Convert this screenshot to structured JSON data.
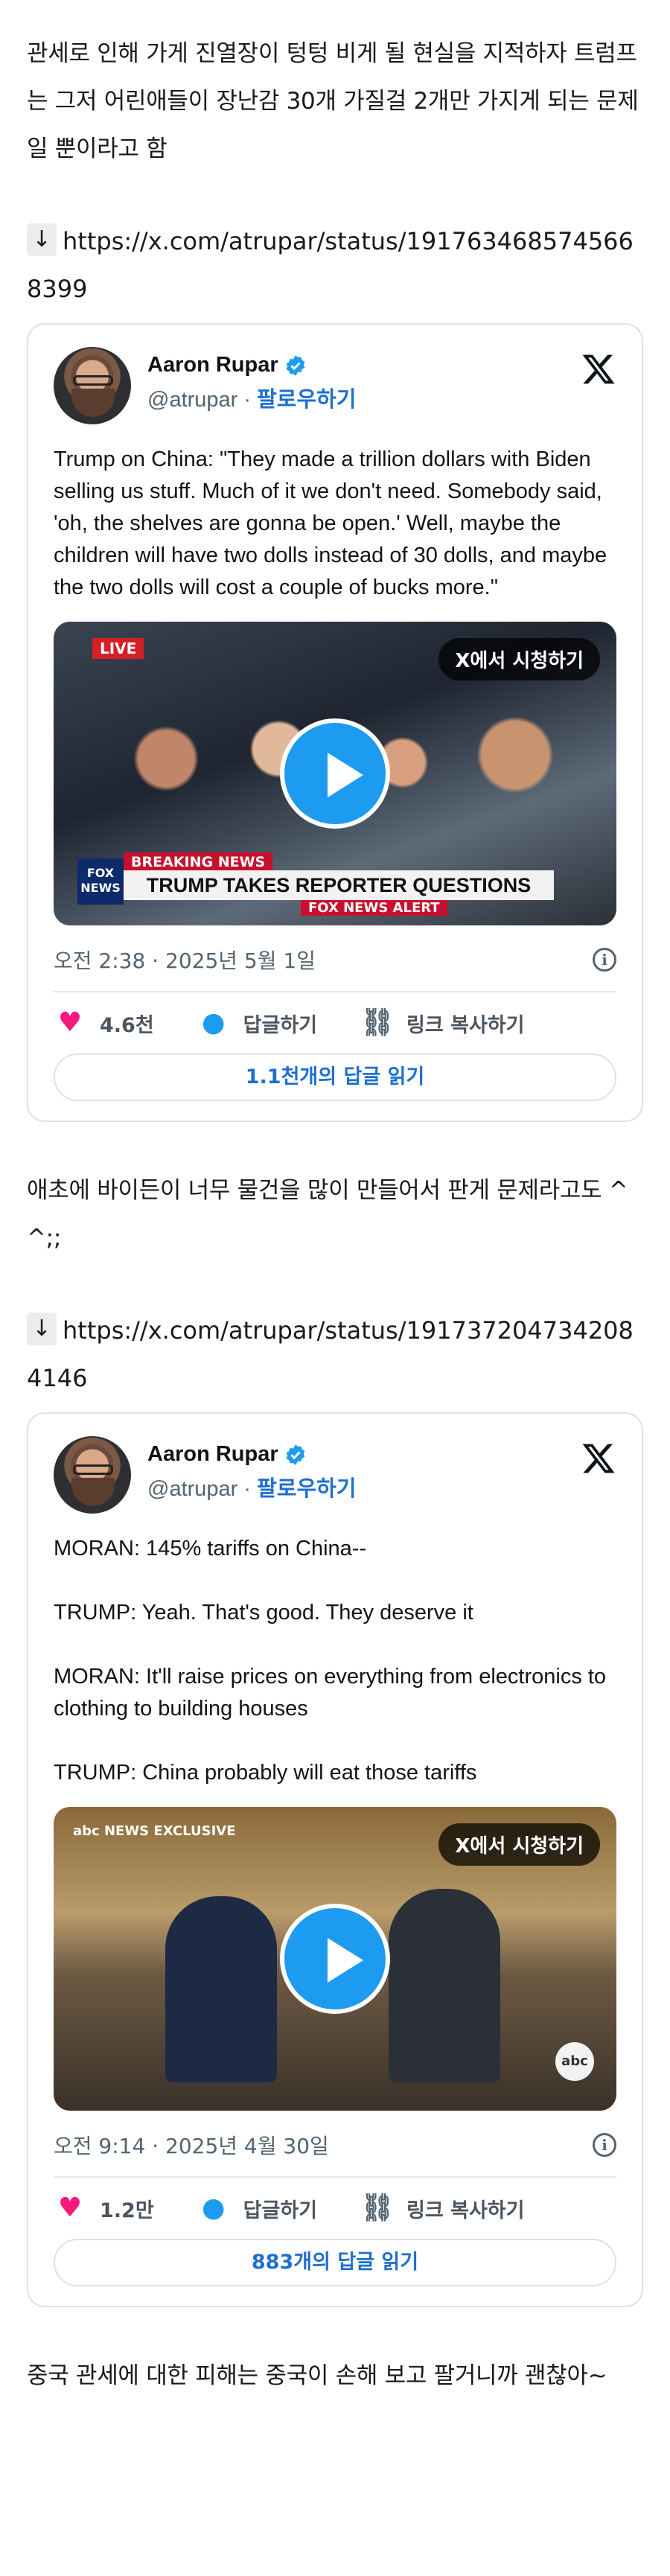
{
  "post": {
    "intro": "관세로 인해 가게 진열장이 텅텅 비게 될 현실을 지적하자 트럼프는 그저 어린애들이 장난감 30개 가질걸 2개만 가지게 되는 문제일 뿐이라고 함",
    "link1_arrow": "↓",
    "link1": "https://x.com/atrupar/status/1917634685745668399",
    "middle": "애초에 바이든이 너무 물건을 많이 만들어서 판게 문제라고도 ^^;;",
    "link2_arrow": "↓",
    "link2": "https://x.com/atrupar/status/1917372047342084146",
    "outro": "중국 관세에 대한 피해는 중국이 손해 보고 팔거니까 괜찮아~"
  },
  "tweets": [
    {
      "name": "Aaron Rupar",
      "handle": "@atrupar",
      "separator": " · ",
      "follow": "팔로우하기",
      "text": "Trump on China: \"They made a trillion dollars with Biden selling us stuff. Much of it we don't need. Somebody said, 'oh, the shelves are gonna be open.' Well, maybe the children will have two dolls instead of 30 dolls, and maybe the two dolls will cost a couple of bucks more.\"",
      "watch": "X에서 시청하기",
      "live": "LIVE",
      "breaking": "BREAKING NEWS",
      "headline": "TRUMP TAKES REPORTER QUESTIONS",
      "alert": "FOX NEWS ALERT",
      "fox": "FOX NEWS",
      "time": "오전 2:38 · 2025년 5월 1일",
      "likes": "4.6천",
      "reply": "답글하기",
      "copy": "링크 복사하기",
      "replies": "1.1천개의 답글 읽기"
    },
    {
      "name": "Aaron Rupar",
      "handle": "@atrupar",
      "separator": " · ",
      "follow": "팔로우하기",
      "lines": [
        "MORAN: 145% tariffs on China--",
        "",
        "TRUMP: Yeah. That's good. They deserve it",
        "",
        "MORAN: It'll raise prices on everything from electronics to clothing to building houses",
        "",
        "TRUMP: China probably will eat those tariffs"
      ],
      "watch": "X에서 시청하기",
      "abc_tag": "abc NEWS EXCLUSIVE",
      "abc": "abc",
      "time": "오전 9:14 · 2025년 4월 30일",
      "likes": "1.2만",
      "reply": "답글하기",
      "copy": "링크 복사하기",
      "replies": "883개의 답글 읽기"
    }
  ],
  "colors": {
    "accent": "#1d9bf0",
    "like": "#f91880",
    "link": "#1d6fd1"
  }
}
